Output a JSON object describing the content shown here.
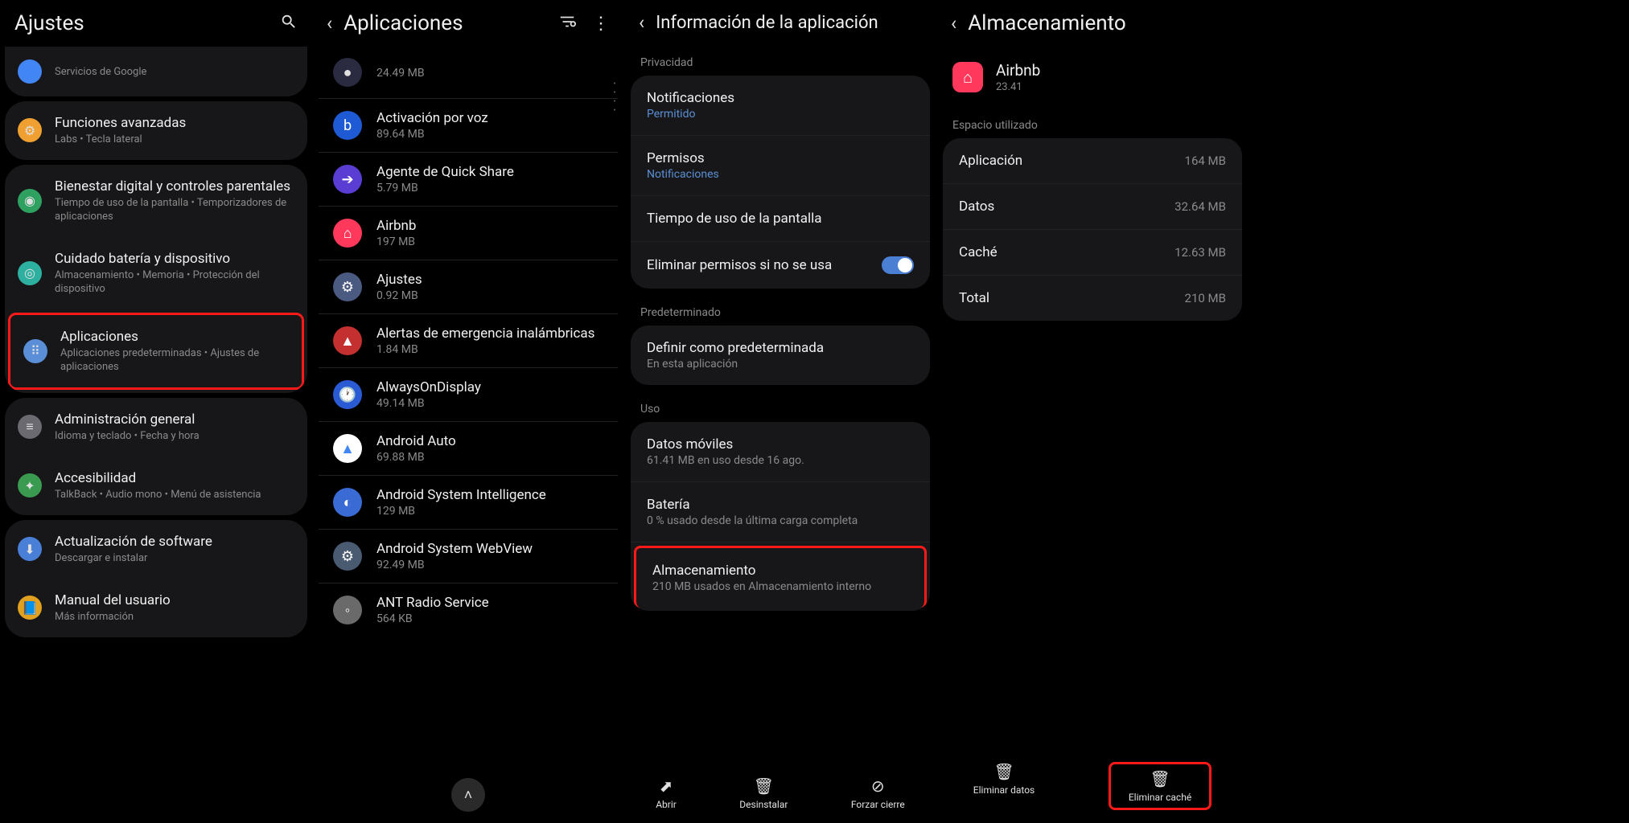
{
  "screen1": {
    "title": "Ajustes",
    "rows": [
      {
        "title": "",
        "sub": "Servicios de Google",
        "iconColor": "#4285f4"
      },
      {
        "title": "Funciones avanzadas",
        "sub": "Labs  •  Tecla lateral",
        "iconColor": "#f0a030"
      },
      {
        "title": "Bienestar digital y controles parentales",
        "sub": "Tiempo de uso de la pantalla  •  Temporizadores de aplicaciones",
        "iconColor": "#2ea060"
      },
      {
        "title": "Cuidado batería y dispositivo",
        "sub": "Almacenamiento  •  Memoria  •  Protección del dispositivo",
        "iconColor": "#2eb0a0"
      },
      {
        "title": "Aplicaciones",
        "sub": "Aplicaciones predeterminadas  •  Ajustes de aplicaciones",
        "iconColor": "#5a8fd8",
        "highlight": true
      },
      {
        "title": "Administración general",
        "sub": "Idioma y teclado  •  Fecha y hora",
        "iconColor": "#6a6a70"
      },
      {
        "title": "Accesibilidad",
        "sub": "TalkBack  •  Audio mono  •  Menú de asistencia",
        "iconColor": "#3a9a50"
      },
      {
        "title": "Actualización de software",
        "sub": "Descargar e instalar",
        "iconColor": "#4a7fd8"
      },
      {
        "title": "Manual del usuario",
        "sub": "Más información",
        "iconColor": "#e0a020"
      }
    ]
  },
  "screen2": {
    "title": "Aplicaciones",
    "apps": [
      {
        "title": "",
        "sub": "24.49 MB",
        "iconBg": "#2a2a40"
      },
      {
        "title": "Activación por voz",
        "sub": "89.64 MB",
        "iconBg": "#1e5ad4"
      },
      {
        "title": "Agente de Quick Share",
        "sub": "5.79 MB",
        "iconBg": "#5a3ed4"
      },
      {
        "title": "Airbnb",
        "sub": "197 MB",
        "iconBg": "#ff385c"
      },
      {
        "title": "Ajustes",
        "sub": "0.92 MB",
        "iconBg": "#4a5a80"
      },
      {
        "title": "Alertas de emergencia inalámbricas",
        "sub": "1.84 MB",
        "iconBg": "#c43030"
      },
      {
        "title": "AlwaysOnDisplay",
        "sub": "49.14 MB",
        "iconBg": "#2a5ad4"
      },
      {
        "title": "Android Auto",
        "sub": "69.88 MB",
        "iconBg": "#ffffff"
      },
      {
        "title": "Android System Intelligence",
        "sub": "129 MB",
        "iconBg": "#3a6ad4"
      },
      {
        "title": "Android System WebView",
        "sub": "92.49 MB",
        "iconBg": "#4a5a70"
      },
      {
        "title": "ANT Radio Service",
        "sub": "564 KB",
        "iconBg": "#6a6a6a"
      }
    ]
  },
  "screen3": {
    "title": "Información de la aplicación",
    "sections": {
      "privacy": "Privacidad",
      "notifications": {
        "title": "Notificaciones",
        "sub": "Permitido"
      },
      "permissions": {
        "title": "Permisos",
        "sub": "Notificaciones"
      },
      "screenTime": "Tiempo de uso de la pantalla",
      "removePerms": "Eliminar permisos si no se usa",
      "default": "Predeterminado",
      "setDefault": {
        "title": "Definir como predeterminada",
        "sub": "En esta aplicación"
      },
      "usage": "Uso",
      "mobileData": {
        "title": "Datos móviles",
        "sub": "61.41 MB en uso desde 16 ago."
      },
      "battery": {
        "title": "Batería",
        "sub": "0 % usado desde la última carga completa"
      },
      "storage": {
        "title": "Almacenamiento",
        "sub": "210 MB usados en Almacenamiento interno"
      }
    },
    "bottomBar": {
      "open": "Abrir",
      "uninstall": "Desinstalar",
      "forceStop": "Forzar cierre"
    }
  },
  "screen4": {
    "title": "Almacenamiento",
    "app": {
      "name": "Airbnb",
      "version": "23.41"
    },
    "spaceUsed": "Espacio utilizado",
    "rows": [
      {
        "label": "Aplicación",
        "value": "164 MB"
      },
      {
        "label": "Datos",
        "value": "32.64 MB"
      },
      {
        "label": "Caché",
        "value": "12.63 MB"
      },
      {
        "label": "Total",
        "value": "210 MB"
      }
    ],
    "bottomBar": {
      "clearData": "Eliminar datos",
      "clearCache": "Eliminar caché"
    }
  }
}
